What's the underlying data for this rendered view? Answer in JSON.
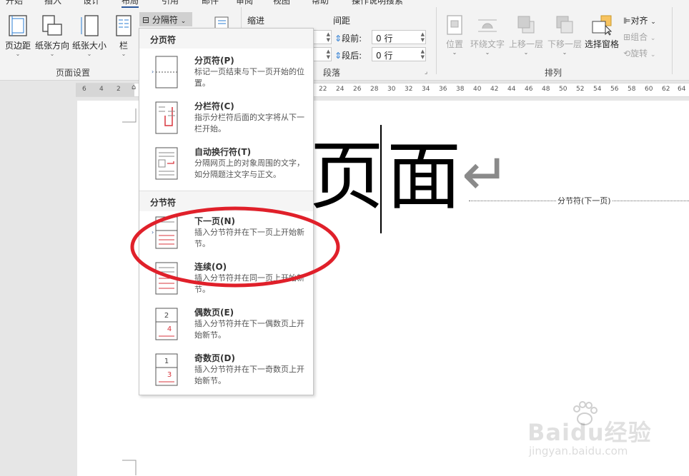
{
  "tabs": [
    "开始",
    "插入",
    "设计",
    "布局",
    "引用",
    "邮件",
    "审阅",
    "视图",
    "帮助",
    "操作说明搜索"
  ],
  "page_setup": {
    "margins": "页边距",
    "orientation": "纸张方向",
    "size": "纸张大小",
    "columns": "栏",
    "breaks": "分隔符",
    "group_label": "页面设置"
  },
  "paragraph": {
    "indent_label": "缩进",
    "spacing_label": "间距",
    "before_label": "段前:",
    "before_value": "0 行",
    "after_label": "段后:",
    "after_value": "0 行",
    "group_label": "段落"
  },
  "arrange": {
    "position": "位置",
    "wrap_text": "环绕文字",
    "bring_forward": "上移一层",
    "send_backward": "下移一层",
    "selection_pane": "选择窗格",
    "align": "对齐",
    "group": "组合",
    "rotate": "旋转",
    "group_label": "排列"
  },
  "ruler_ticks": [
    "6",
    "4",
    "2",
    "22",
    "24",
    "26",
    "28",
    "30",
    "32",
    "34",
    "36",
    "38",
    "40",
    "42",
    "44",
    "46",
    "48",
    "50",
    "52",
    "54",
    "56",
    "58",
    "60",
    "62",
    "64"
  ],
  "menu": {
    "page_breaks_header": "分页符",
    "section_breaks_header": "分节符",
    "items": [
      {
        "title": "分页符(P)",
        "desc": "标记一页结束与下一页开始的位置。"
      },
      {
        "title": "分栏符(C)",
        "desc": "指示分栏符后面的文字将从下一栏开始。"
      },
      {
        "title": "自动换行符(T)",
        "desc": "分隔网页上的对象周围的文字，如分隔题注文字与正文。"
      },
      {
        "title": "下一页(N)",
        "desc": "插入分节符并在下一页上开始新节。"
      },
      {
        "title": "连续(O)",
        "desc": "插入分节符并在同一页上开始新节。"
      },
      {
        "title": "偶数页(E)",
        "desc": "插入分节符并在下一偶数页上开始新节。"
      },
      {
        "title": "奇数页(D)",
        "desc": "插入分节符并在下一奇数页上开始新节。"
      }
    ]
  },
  "document": {
    "char1": "页",
    "char2": "面",
    "return_mark": "↵",
    "section_break_label": "分节符(下一页)"
  },
  "watermark": {
    "brand": "Baidu经验",
    "url": "jingyan.baidu.com"
  },
  "colors": {
    "accent": "#2b579a",
    "annotation_red": "#e0202a"
  }
}
